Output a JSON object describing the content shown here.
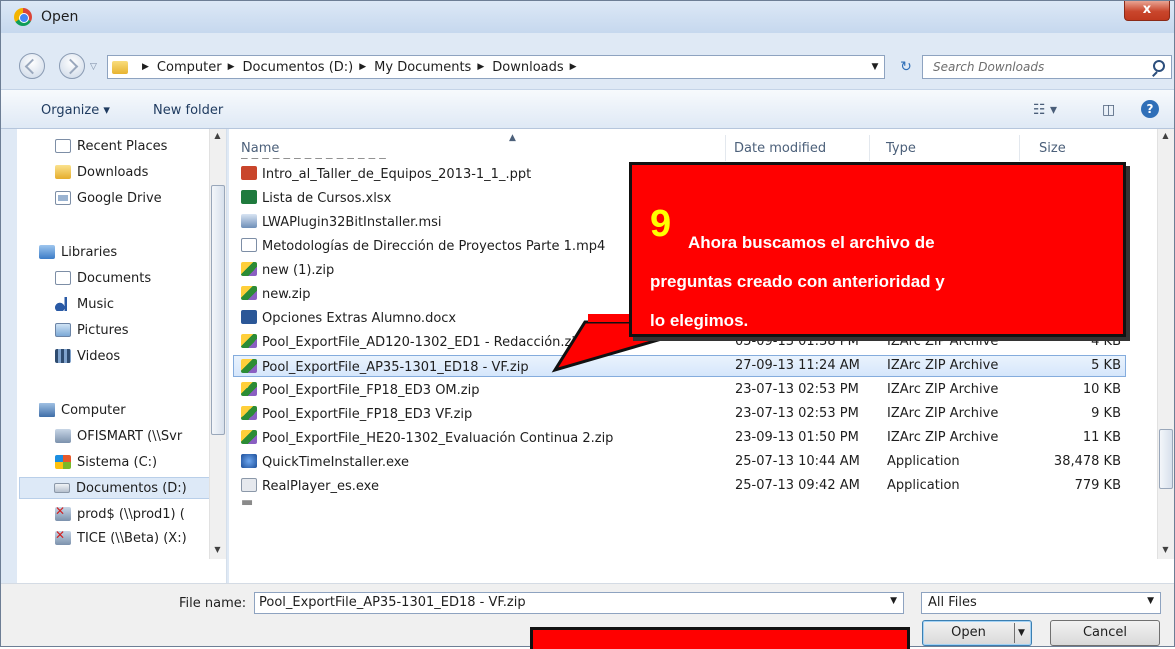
{
  "window": {
    "title": "Open",
    "close_label": "x"
  },
  "address": {
    "crumbs": [
      "Computer",
      "Documentos (D:)",
      "My Documents",
      "Downloads"
    ],
    "search_placeholder": "Search Downloads"
  },
  "toolbar": {
    "organize": "Organize ▾",
    "new_folder": "New folder",
    "help": "?"
  },
  "nav": {
    "items": [
      {
        "label": "Recent Places",
        "icon": "recent-places-icon"
      },
      {
        "label": "Downloads",
        "icon": "folder-icon"
      },
      {
        "label": "Google Drive",
        "icon": "google-drive-icon"
      },
      {
        "label": "Libraries",
        "icon": "libraries-icon"
      },
      {
        "label": "Documents",
        "icon": "documents-icon"
      },
      {
        "label": "Music",
        "icon": "music-icon"
      },
      {
        "label": "Pictures",
        "icon": "pictures-icon"
      },
      {
        "label": "Videos",
        "icon": "videos-icon"
      },
      {
        "label": "Computer",
        "icon": "computer-icon"
      },
      {
        "label": "OFISMART (\\\\Svr",
        "icon": "network-drive-icon"
      },
      {
        "label": "Sistema (C:)",
        "icon": "system-drive-icon"
      },
      {
        "label": "Documentos (D:)",
        "icon": "drive-icon"
      },
      {
        "label": "prod$ (\\\\prod1) (",
        "icon": "disconnected-drive-icon"
      },
      {
        "label": "TICE (\\\\Beta) (X:)",
        "icon": "disconnected-drive-icon"
      }
    ]
  },
  "columns": {
    "name": "Name",
    "date": "Date modified",
    "type": "Type",
    "size": "Size"
  },
  "files": [
    {
      "name": "Intro_al_Taller_de_Equipos_2013-1_1_.ppt",
      "date": "",
      "type": "",
      "size": ""
    },
    {
      "name": "Lista de Cursos.xlsx",
      "date": "",
      "type": "",
      "size": ""
    },
    {
      "name": "LWAPlugin32BitInstaller.msi",
      "date": "",
      "type": "",
      "size": ""
    },
    {
      "name": "Metodologías de Dirección de Proyectos Parte 1.mp4",
      "date": "",
      "type": "",
      "size": ""
    },
    {
      "name": "new (1).zip",
      "date": "",
      "type": "",
      "size": ""
    },
    {
      "name": "new.zip",
      "date": "",
      "type": "",
      "size": ""
    },
    {
      "name": "Opciones Extras Alumno.docx",
      "date": "",
      "type": "",
      "size": ""
    },
    {
      "name": "Pool_ExportFile_AD120-1302_ED1 - Redacción.zip",
      "date": "05-09-13 01:38 PM",
      "type": "IZArc ZIP Archive",
      "size": "4 KB"
    },
    {
      "name": "Pool_ExportFile_AP35-1301_ED18 - VF.zip",
      "date": "27-09-13 11:24 AM",
      "type": "IZArc ZIP Archive",
      "size": "5 KB"
    },
    {
      "name": "Pool_ExportFile_FP18_ED3 OM.zip",
      "date": "23-07-13 02:53 PM",
      "type": "IZArc ZIP Archive",
      "size": "10 KB"
    },
    {
      "name": "Pool_ExportFile_FP18_ED3 VF.zip",
      "date": "23-07-13 02:53 PM",
      "type": "IZArc ZIP Archive",
      "size": "9 KB"
    },
    {
      "name": "Pool_ExportFile_HE20-1302_Evaluación Continua 2.zip",
      "date": "23-09-13 01:50 PM",
      "type": "IZArc ZIP Archive",
      "size": "11 KB"
    },
    {
      "name": "QuickTimeInstaller.exe",
      "date": "25-07-13 10:44 AM",
      "type": "Application",
      "size": "38,478 KB"
    },
    {
      "name": "RealPlayer_es.exe",
      "date": "25-07-13 09:42 AM",
      "type": "Application",
      "size": "779 KB"
    }
  ],
  "footer": {
    "file_name_label": "File name:",
    "file_name_value": "Pool_ExportFile_AP35-1301_ED18 - VF.zip",
    "filter": "All Files",
    "open": "Open",
    "cancel": "Cancel"
  },
  "callout": {
    "number": "9",
    "line1": "Ahora buscamos el archivo de",
    "line2": "preguntas creado con anterioridad y",
    "line3": "lo elegimos."
  }
}
